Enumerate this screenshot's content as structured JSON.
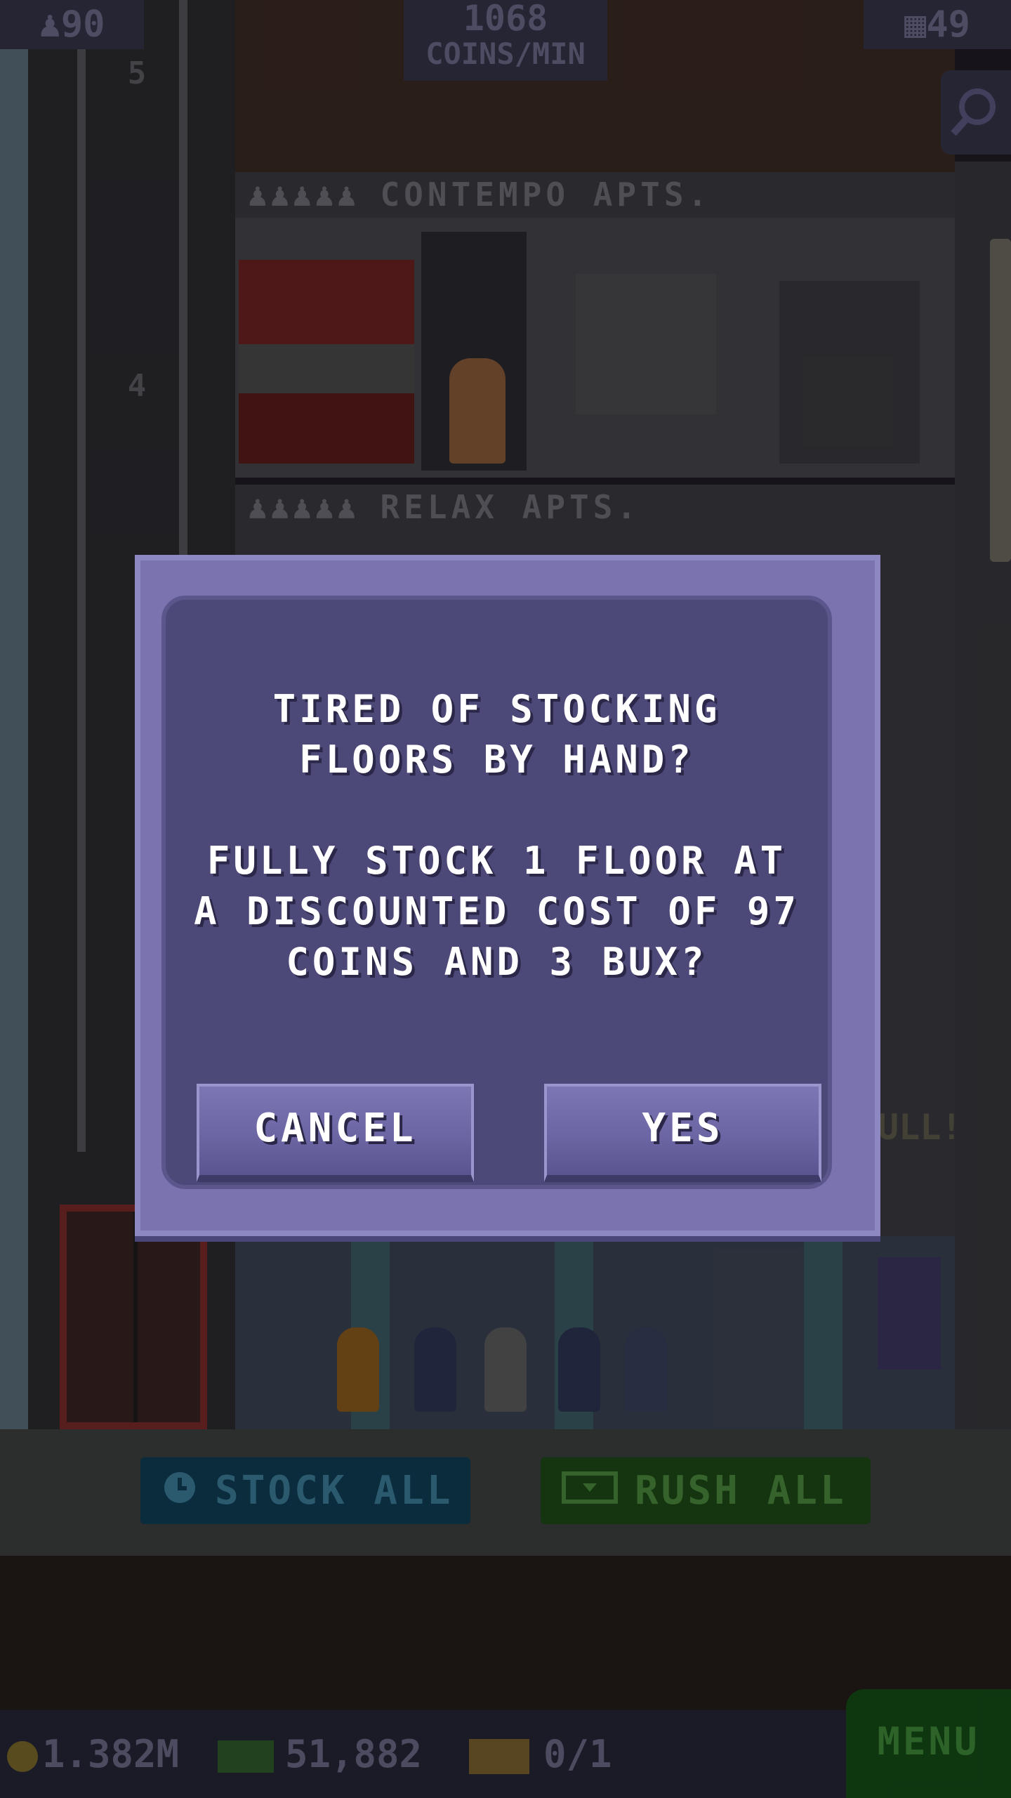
{
  "hud": {
    "population": "90",
    "coins_per_min_value": "1068",
    "coins_per_min_label": "COINS/MIN",
    "floors": "49"
  },
  "floors": [
    {
      "name": "CONTEMPO APTS."
    },
    {
      "name": "RELAX APTS."
    }
  ],
  "floor_numbers": [
    "5",
    "4"
  ],
  "lobby_sign": "ULL!",
  "dialog": {
    "line1": "TIRED OF STOCKING FLOORS BY HAND?",
    "line2": "FULLY STOCK 1 FLOOR AT A DISCOUNTED COST OF 97 COINS AND 3 BUX?",
    "cancel_label": "CANCEL",
    "yes_label": "YES"
  },
  "actions": {
    "stock_all_label": "STOCK ALL",
    "rush_all_label": "RUSH ALL"
  },
  "status": {
    "coins": "1.382M",
    "bux": "51,882",
    "tickets": "0/1",
    "menu_label": "MENU"
  },
  "colors": {
    "dialog_bg": "#4c4878",
    "dialog_frame": "#7a73b0",
    "stock_accent": "#0f3e55",
    "rush_accent": "#1d4a17"
  },
  "icons": [
    "person-icon",
    "building-icon",
    "search-icon",
    "clock-icon",
    "bux-icon",
    "coin-icon",
    "ticket-icon"
  ]
}
